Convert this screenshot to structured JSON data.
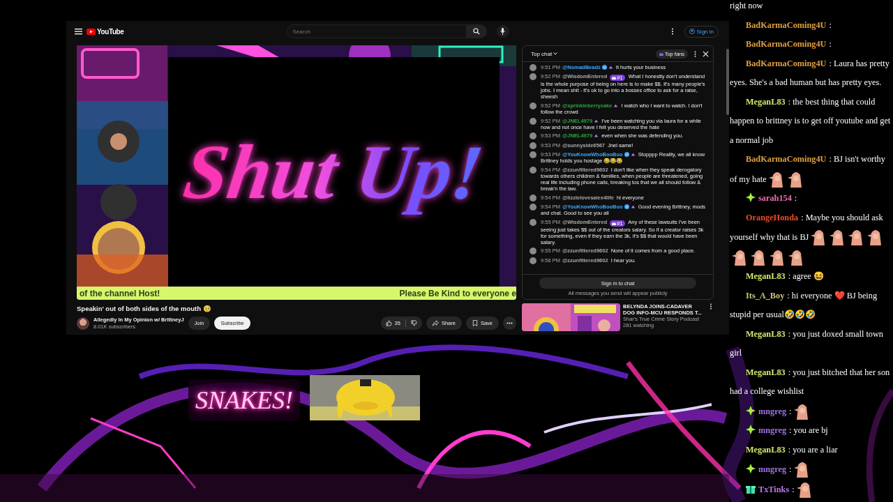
{
  "youtube": {
    "header": {
      "logo": "YouTube",
      "search_placeholder": "Search",
      "sign_in": "Sign in"
    },
    "video": {
      "overlay_text": "Shut Up!",
      "ticker": [
        "of the channel Host!",
        "Please Be Kind to everyone e"
      ]
    },
    "title": "Speakin' out of both sides of the mouth 🥺",
    "channel": {
      "name": "Allegedly In My Opinion w/ BrittneyJ",
      "subscribers": "8.01K subscribers"
    },
    "actions": {
      "join": "Join",
      "subscribe": "Subscribe",
      "likes": "35",
      "share": "Share",
      "save": "Save"
    },
    "chat": {
      "mode": "Top chat",
      "top_fans": "Top fans",
      "sign_in": "Sign in to chat",
      "notice": "All messages you send will appear publicly",
      "messages": [
        {
          "time": "9:51 PM",
          "author": "@NomadBeadz",
          "color": "#3ea6ff",
          "verified": true,
          "member": true,
          "text": "It hurts your business"
        },
        {
          "time": "9:52 PM",
          "author": "@WisdomEntered",
          "color": "#aaaaaa",
          "verified": false,
          "member": false,
          "badge": "#1",
          "text": "What I honestly don't understand is the whole purpose of being on here is to make $$. It's many people's jobs. I mean shit - it's ok to go into a bosses office to ask for a raise, sheesh"
        },
        {
          "time": "9:52 PM",
          "author": "@sprinkleberrycake",
          "color": "#2ba640",
          "verified": false,
          "member": true,
          "text": "I watch who I want to watch. I don't follow the crowd"
        },
        {
          "time": "9:52 PM",
          "author": "@JNEL4979",
          "color": "#2ba640",
          "verified": false,
          "member": true,
          "text": "I've been watching you via laura for a while now and not once have I felt you deserved the hate"
        },
        {
          "time": "9:53 PM",
          "author": "@JNEL4979",
          "color": "#2ba640",
          "verified": false,
          "member": true,
          "text": "even when she was defending you."
        },
        {
          "time": "9:53 PM",
          "author": "@sunnyside6567",
          "color": "#aaaaaa",
          "verified": false,
          "member": false,
          "text": "Jnel same!"
        },
        {
          "time": "9:53 PM",
          "author": "@YouKnowWhoBooBoo",
          "color": "#3ea6ff",
          "verified": true,
          "member": true,
          "text": "Stopppp Reality, we all know Brittney holds you hostage 😂😂😂"
        },
        {
          "time": "9:54 PM",
          "author": "@zzunfiltered9602",
          "color": "#aaaaaa",
          "verified": false,
          "member": false,
          "text": "I don't like when they speak derogatory towards others children & families, when people are threatened, going real life including phone calls, breaking tos that we all should follow & break'n the law."
        },
        {
          "time": "9:54 PM",
          "author": "@lizzielovesalex4life",
          "color": "#aaaaaa",
          "verified": false,
          "member": false,
          "text": "hi everyone"
        },
        {
          "time": "9:54 PM",
          "author": "@YouKnowWhoBooBoo",
          "color": "#3ea6ff",
          "verified": true,
          "member": true,
          "text": "Good evening Brittney, mods and chat. Good to see you all"
        },
        {
          "time": "9:55 PM",
          "author": "@WisdomEntered",
          "color": "#aaaaaa",
          "verified": false,
          "member": false,
          "badge": "#1",
          "text": "Any of these lawsuits I've been seeing just takes $$ out of the creators salary. So if a creator raises 3k for something, even if they earn the 3k, it's $$ that would have been salary."
        },
        {
          "time": "9:55 PM",
          "author": "@zzunfiltered9602",
          "color": "#aaaaaa",
          "verified": false,
          "member": false,
          "text": "None of it comes from a good place."
        },
        {
          "time": "9:56 PM",
          "author": "@zzunfiltered9602",
          "color": "#aaaaaa",
          "verified": false,
          "member": false,
          "text": "I hear you."
        }
      ]
    },
    "recommended": {
      "title": "BELYNDA JOINS-CADAVER DOG INFO-MCU RESPONDS T...",
      "channel": "Shar's True Crime Story Podcast",
      "viewers": "281 watching"
    }
  },
  "overlay": {
    "sign": "SNAKES!",
    "chat": [
      {
        "kind": "viewer",
        "text": "right now"
      },
      {
        "author": "BadKarmaComing4U",
        "color": "#e0a040",
        "text": ":"
      },
      {
        "author": "BadKarmaComing4U",
        "color": "#e0a040",
        "text": ":"
      },
      {
        "author": "BadKarmaComing4U",
        "color": "#e0a040",
        "text": ": Laura has pretty eyes. She's a bad human but has pretty eyes."
      },
      {
        "author": "MeganL83",
        "color": "#d8e870",
        "text": ": the best thing that could happen to brittney is to get off youtube and get a normal job"
      },
      {
        "author": "BadKarmaComing4U",
        "color": "#e0a040",
        "text": ": BJ isn't worthy of my hate",
        "emotes": [
          {
            "kind": "sticker"
          },
          {
            "kind": "sticker"
          }
        ]
      },
      {
        "kind": "member",
        "author": "sarah154",
        "color": "#f070b0",
        "text": ":"
      },
      {
        "author": "OrangeHonda",
        "color": "#f04a28",
        "text": ": Maybe you should ask yourself why that is BJ",
        "emotes": [
          {
            "kind": "sticker"
          },
          {
            "kind": "sticker"
          },
          {
            "kind": "sticker"
          },
          {
            "kind": "sticker"
          },
          {
            "kind": "sticker"
          },
          {
            "kind": "sticker"
          },
          {
            "kind": "sticker"
          },
          {
            "kind": "sticker"
          }
        ]
      },
      {
        "author": "MeganL83",
        "color": "#d8e870",
        "text": ": agree 😆"
      },
      {
        "author": "Its_A_Boy",
        "color": "#c8c878",
        "text": ": hi everyone ❤️ BJ being stupid per usual🤣🤣🤣"
      },
      {
        "author": "MeganL83",
        "color": "#d8e870",
        "text": ": you just doxed small town girl"
      },
      {
        "author": "MeganL83",
        "color": "#d8e870",
        "text": ": you just bitched that her son had a college wishlist"
      },
      {
        "kind": "member",
        "author": "mngreg",
        "color": "#a070e8",
        "text": ":",
        "emotes": [
          {
            "kind": "sticker"
          }
        ]
      },
      {
        "kind": "member",
        "author": "mngreg",
        "color": "#a070e8",
        "text": ": you are bj"
      },
      {
        "author": "MeganL83",
        "color": "#d8e870",
        "text": ": you are a liar"
      },
      {
        "kind": "member",
        "author": "mngreg",
        "color": "#a070e8",
        "text": ":",
        "emotes": [
          {
            "kind": "sticker"
          }
        ]
      },
      {
        "kind": "gifter",
        "author": "TxTinks",
        "color": "#b878e8",
        "text": ":",
        "emotes": [
          {
            "kind": "sticker"
          }
        ]
      }
    ]
  }
}
